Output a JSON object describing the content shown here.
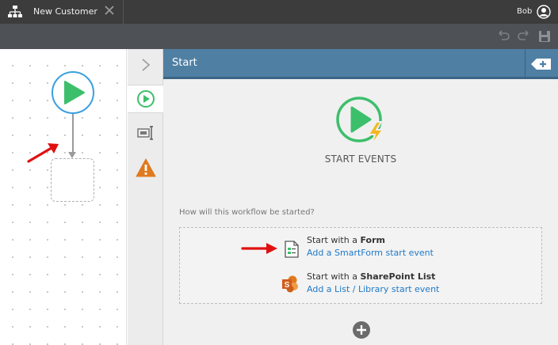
{
  "topbar": {
    "tab_title": "New Customer",
    "user_name": "Bob"
  },
  "panel": {
    "title": "Start",
    "event_heading": "START EVENTS",
    "question": "How will this workflow be started?",
    "options": [
      {
        "prefix": "Start with a ",
        "bold": "Form",
        "link": "Add a SmartForm start event",
        "icon": "smartform-icon"
      },
      {
        "prefix": "Start with a ",
        "bold": "SharePoint List",
        "link": "Add a List / Library start event",
        "icon": "sharepoint-icon"
      }
    ]
  },
  "colors": {
    "accent_blue": "#4f7fa3",
    "start_green": "#3cbf6b",
    "link_blue": "#1f7ac8",
    "annotation_red": "#e01010",
    "warning_orange": "#e07a1f"
  }
}
